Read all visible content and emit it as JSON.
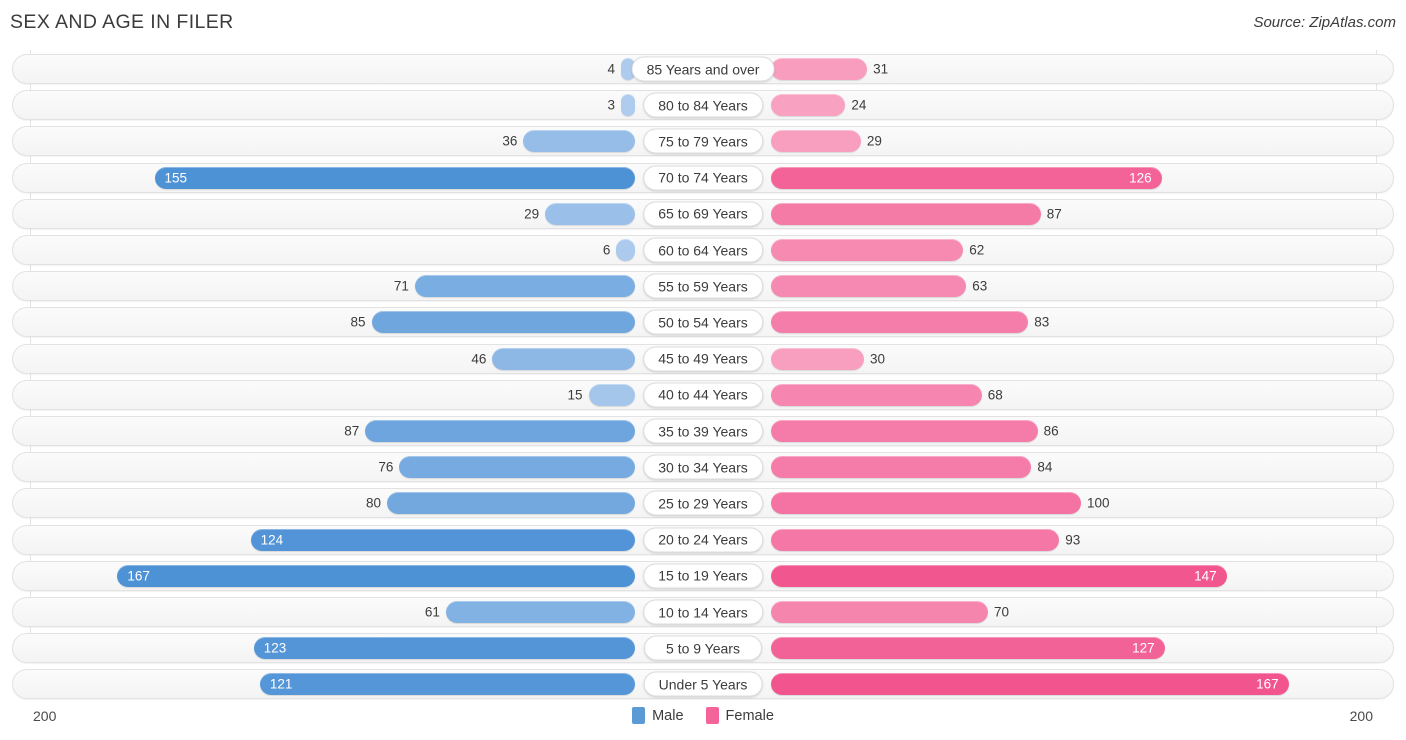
{
  "header": {
    "title": "SEX AND AGE IN FILER",
    "source": "Source: ZipAtlas.com"
  },
  "legend": {
    "male_label": "Male",
    "female_label": "Female",
    "male_color": "#5B9BD5",
    "female_color": "#F4649B"
  },
  "axis": {
    "left_max": "200",
    "right_max": "200"
  },
  "chart_data": {
    "type": "bar",
    "subtype": "population-pyramid",
    "title": "SEX AND AGE IN FILER",
    "xlabel": "",
    "ylabel": "",
    "xlim": [
      200,
      200
    ],
    "axis_max": 200,
    "grid": true,
    "legend_position": "bottom-center",
    "categories": [
      "85 Years and over",
      "80 to 84 Years",
      "75 to 79 Years",
      "70 to 74 Years",
      "65 to 69 Years",
      "60 to 64 Years",
      "55 to 59 Years",
      "50 to 54 Years",
      "45 to 49 Years",
      "40 to 44 Years",
      "35 to 39 Years",
      "30 to 34 Years",
      "25 to 29 Years",
      "20 to 24 Years",
      "15 to 19 Years",
      "10 to 14 Years",
      "5 to 9 Years",
      "Under 5 Years"
    ],
    "series": [
      {
        "name": "Male",
        "color": "#5B9BD5",
        "values": [
          4,
          3,
          36,
          155,
          29,
          6,
          71,
          85,
          46,
          15,
          87,
          76,
          80,
          124,
          167,
          61,
          123,
          121
        ]
      },
      {
        "name": "Female",
        "color": "#F4649B",
        "values": [
          31,
          24,
          29,
          126,
          87,
          62,
          63,
          83,
          30,
          68,
          86,
          84,
          100,
          93,
          147,
          70,
          127,
          167
        ]
      }
    ]
  },
  "rows": [
    {
      "label": "85 Years and over",
      "male": 4,
      "female": 31
    },
    {
      "label": "80 to 84 Years",
      "male": 3,
      "female": 24
    },
    {
      "label": "75 to 79 Years",
      "male": 36,
      "female": 29
    },
    {
      "label": "70 to 74 Years",
      "male": 155,
      "female": 126
    },
    {
      "label": "65 to 69 Years",
      "male": 29,
      "female": 87
    },
    {
      "label": "60 to 64 Years",
      "male": 6,
      "female": 62
    },
    {
      "label": "55 to 59 Years",
      "male": 71,
      "female": 63
    },
    {
      "label": "50 to 54 Years",
      "male": 85,
      "female": 83
    },
    {
      "label": "45 to 49 Years",
      "male": 46,
      "female": 30
    },
    {
      "label": "40 to 44 Years",
      "male": 15,
      "female": 68
    },
    {
      "label": "35 to 39 Years",
      "male": 87,
      "female": 86
    },
    {
      "label": "30 to 34 Years",
      "male": 76,
      "female": 84
    },
    {
      "label": "25 to 29 Years",
      "male": 80,
      "female": 100
    },
    {
      "label": "20 to 24 Years",
      "male": 124,
      "female": 93
    },
    {
      "label": "15 to 19 Years",
      "male": 167,
      "female": 147
    },
    {
      "label": "10 to 14 Years",
      "male": 61,
      "female": 70
    },
    {
      "label": "5 to 9 Years",
      "male": 123,
      "female": 127
    },
    {
      "label": "Under 5 Years",
      "male": 121,
      "female": 167
    }
  ]
}
